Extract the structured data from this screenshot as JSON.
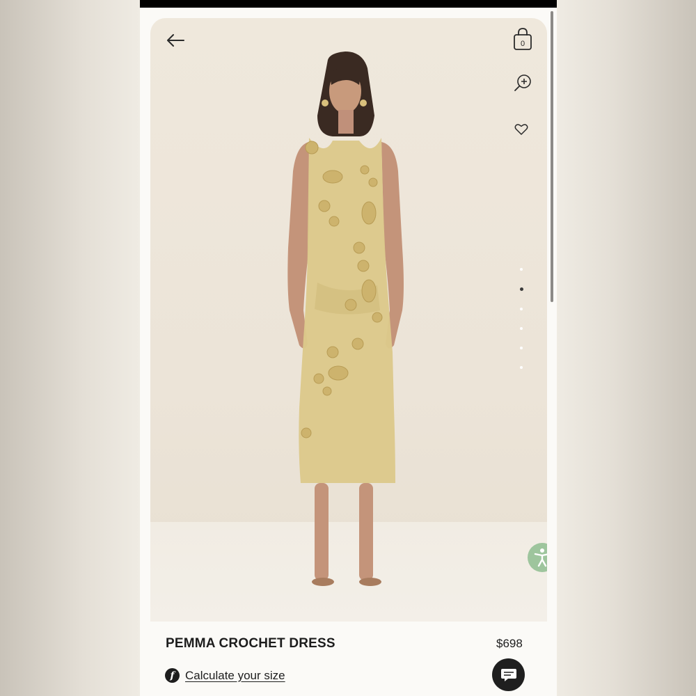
{
  "product": {
    "name": "PEMMA CROCHET DRESS",
    "price": "$698",
    "size_link": "Calculate your size"
  },
  "cart": {
    "count": "0"
  },
  "gallery": {
    "total_images": 6,
    "active_index": 1
  },
  "icons": {
    "back": "arrow-left-icon",
    "bag": "shopping-bag-icon",
    "zoom": "zoom-in-icon",
    "wishlist": "heart-icon",
    "accessibility": "accessibility-icon",
    "chat": "chat-icon",
    "fit": "fit-calculator-icon"
  },
  "colors": {
    "accessibility_button": "#9ec59d",
    "chat_button": "#1f1f1f",
    "dress": "#dcc98a"
  }
}
